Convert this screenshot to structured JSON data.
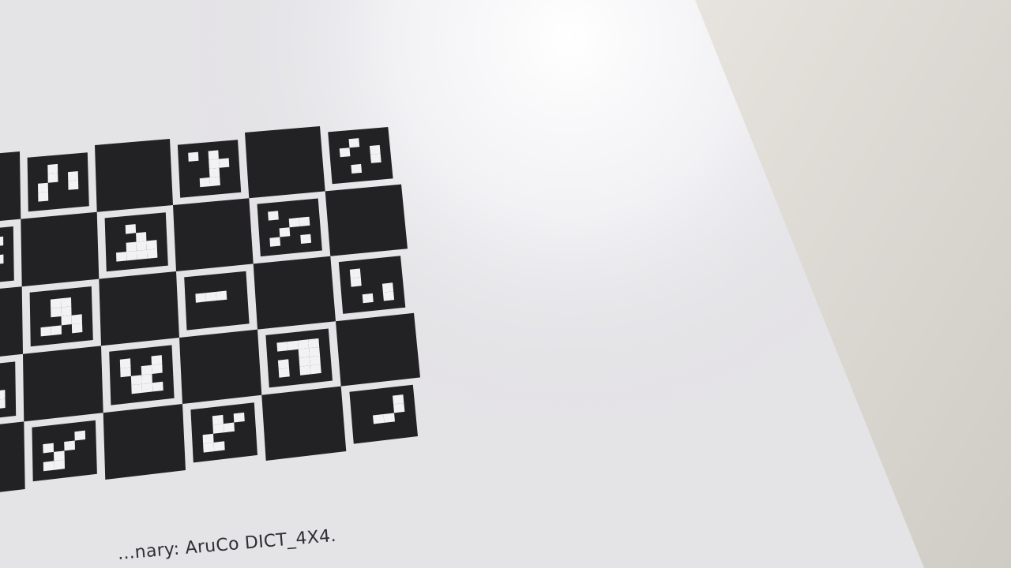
{
  "caption": {
    "text": "...nary: AruCo DICT_4X4."
  },
  "board": {
    "type": "charuco",
    "dictionary": "DICT_4X4"
  },
  "colors": {
    "paper": "#e6e5e8",
    "paper_highlight": "#ffffff",
    "background_right": "#d8d5d0",
    "board_black": "#222225",
    "marker_white": "#f2f2f4"
  }
}
